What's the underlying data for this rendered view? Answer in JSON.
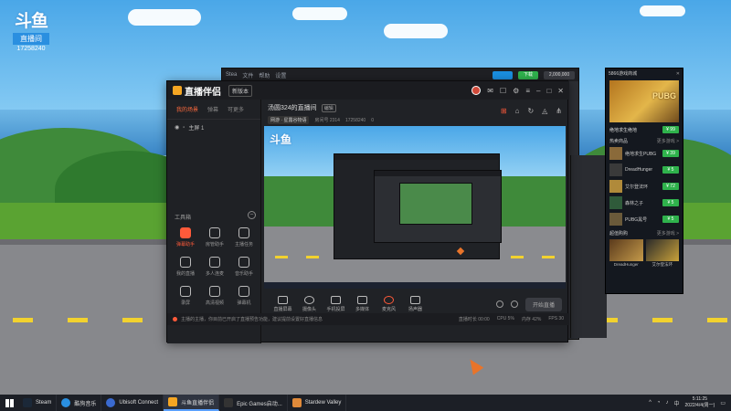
{
  "desktop": {
    "logo_text": "斗鱼",
    "logo_tag": "直播间",
    "logo_number": "17258240"
  },
  "back_window": {
    "menu": [
      "Stea",
      "文件",
      "帮助",
      "设置"
    ],
    "btn_green": "下载",
    "btn_dark": "2,000,000"
  },
  "main_window": {
    "app_name": "直播伴侣",
    "version_label": "新版本",
    "sidebar": {
      "tabs": [
        "我的场景",
        "弹幕",
        "可更多"
      ],
      "scene_item": "主屏 1",
      "tools_label": "工具箱",
      "tools": [
        {
          "label": "弹幕助手",
          "active": true
        },
        {
          "label": "房管助手",
          "active": false
        },
        {
          "label": "主播任务",
          "active": false
        },
        {
          "label": "我的直播",
          "active": false
        },
        {
          "label": "多人连麦",
          "active": false
        },
        {
          "label": "音乐助手",
          "active": false
        },
        {
          "label": "录屏",
          "active": false
        },
        {
          "label": "高清视频",
          "active": false
        },
        {
          "label": "弹幕机",
          "active": false
        }
      ]
    },
    "room": {
      "title": "汤圆324的直播间",
      "edit": "编辑",
      "category": "网游 · 星露谷物语",
      "room_no": "房间号 2314",
      "uid": "17258240",
      "followers": "0"
    },
    "controls": [
      {
        "label": "直播屏幕",
        "icon": "monitor-icon"
      },
      {
        "label": "摄像头",
        "icon": "camera-icon"
      },
      {
        "label": "手机投屏",
        "icon": "phone-cast-icon"
      },
      {
        "label": "多媒体",
        "icon": "media-icon"
      },
      {
        "label": "麦克风",
        "icon": "microphone-icon"
      },
      {
        "label": "扬声器",
        "icon": "speaker-icon"
      }
    ],
    "start_button": "开始直播",
    "status": {
      "notice": "主播的主播，你目前已开启了直播预告功能，建议提前设置好直播信息",
      "stats": [
        "直播时长 00:00",
        "CPU 5%",
        "内存 42%",
        "FPS 30"
      ]
    }
  },
  "side_panel": {
    "title": "5866游戏商城",
    "featured_name": "绝地求生绝地",
    "featured_price": "¥ 99",
    "section_hot": "热卖商品",
    "section_hot_more": "更多游戏 >",
    "hot_items": [
      {
        "name": "绝地求生PUBG",
        "price": "¥ 39"
      },
      {
        "name": "DreadHunger",
        "price": "¥ 5"
      },
      {
        "name": "艾尔登法环",
        "price": "¥ 72"
      },
      {
        "name": "森林之子",
        "price": "¥ 5"
      },
      {
        "name": "PUBG黑号",
        "price": "¥ 5"
      }
    ],
    "section_bundle": "超值购购",
    "section_bundle_more": "更多游戏 >",
    "bundles": [
      {
        "name": "DreadHunger"
      },
      {
        "name": "艾尔登法环"
      }
    ]
  },
  "taskbar": {
    "items": [
      {
        "label": "Steam",
        "active": false
      },
      {
        "label": "酷狗音乐",
        "active": false
      },
      {
        "label": "Ubisoft Connect",
        "active": false
      },
      {
        "label": "斗鱼直播伴侣",
        "active": true
      },
      {
        "label": "Epic Games启动...",
        "active": false
      },
      {
        "label": "Stardew Valley",
        "active": false
      }
    ],
    "time": "5:11:25",
    "date": "2022/4/4(周一)"
  },
  "colors": {
    "accent": "#ff5a3a",
    "price_green": "#2fb24c",
    "brand_blue": "#2a8fe0"
  }
}
